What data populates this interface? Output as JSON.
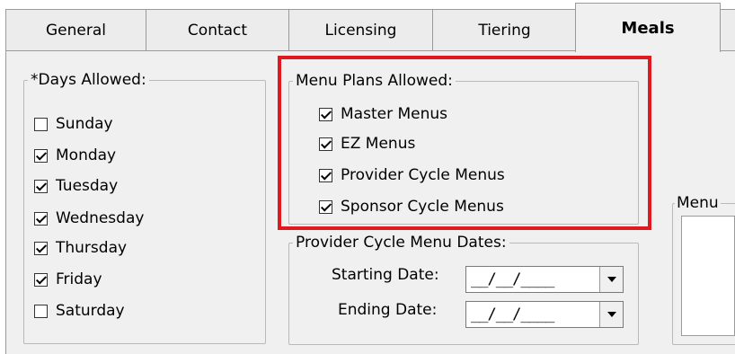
{
  "tabs": [
    {
      "label": "General"
    },
    {
      "label": "Contact"
    },
    {
      "label": "Licensing"
    },
    {
      "label": "Tiering"
    },
    {
      "label": "Meals",
      "active": true
    },
    {
      "label": ""
    }
  ],
  "days_group": {
    "legend": "*Days Allowed:",
    "items": [
      {
        "label": "Sunday",
        "checked": false
      },
      {
        "label": "Monday",
        "checked": true
      },
      {
        "label": "Tuesday",
        "checked": true
      },
      {
        "label": "Wednesday",
        "checked": true
      },
      {
        "label": "Thursday",
        "checked": true
      },
      {
        "label": "Friday",
        "checked": true
      },
      {
        "label": "Saturday",
        "checked": false
      }
    ]
  },
  "menu_plans_group": {
    "legend": "Menu Plans Allowed:",
    "items": [
      {
        "label": "Master Menus",
        "checked": true
      },
      {
        "label": "EZ Menus",
        "checked": true
      },
      {
        "label": "Provider Cycle Menus",
        "checked": true
      },
      {
        "label": "Sponsor Cycle Menus",
        "checked": true
      }
    ]
  },
  "cycle_dates_group": {
    "legend": "Provider Cycle Menu Dates:",
    "starting_label": "Starting Date:",
    "starting_value": "__/__/____",
    "ending_label": "Ending Date:",
    "ending_value": "__/__/____"
  },
  "menu_group": {
    "legend": "Menu"
  },
  "highlight_color": "#e0181f"
}
